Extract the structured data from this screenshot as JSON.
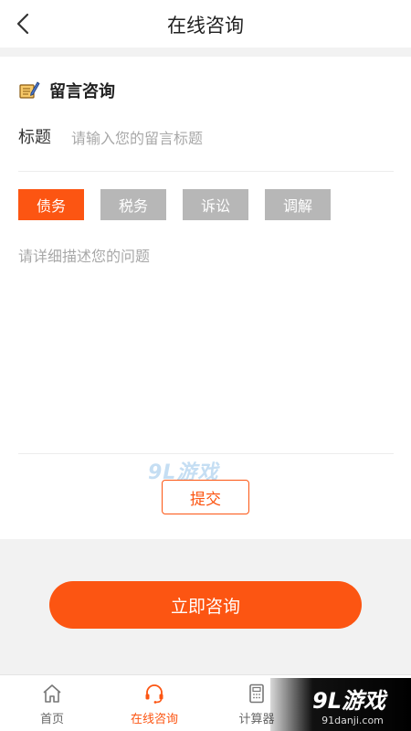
{
  "header": {
    "title": "在线咨询"
  },
  "section": {
    "title": "留言咨询"
  },
  "form": {
    "title_label": "标题",
    "title_placeholder": "请输入您的留言标题",
    "tags": [
      {
        "label": "债务",
        "active": true
      },
      {
        "label": "税务",
        "active": false
      },
      {
        "label": "诉讼",
        "active": false
      },
      {
        "label": "调解",
        "active": false
      }
    ],
    "desc_placeholder": "请详细描述您的问题",
    "submit_label": "提交"
  },
  "consult_button": {
    "label": "立即咨询"
  },
  "tabbar": {
    "items": [
      {
        "label": "首页",
        "icon": "home-icon",
        "active": false
      },
      {
        "label": "在线咨询",
        "icon": "headset-icon",
        "active": true
      },
      {
        "label": "计算器",
        "icon": "calculator-icon",
        "active": false
      }
    ]
  },
  "watermark": {
    "main": "9L游戏",
    "sub": "91danji.com"
  },
  "colors": {
    "accent": "#fc5512",
    "tag_inactive": "#b7b7b7"
  }
}
